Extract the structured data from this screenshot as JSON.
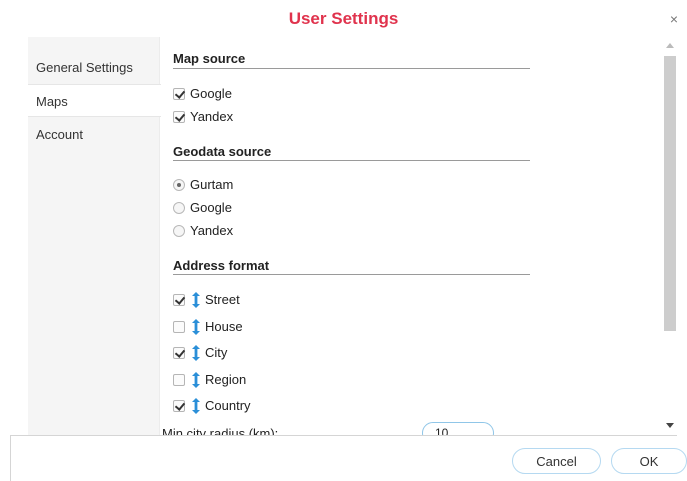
{
  "dialog": {
    "title": "User Settings",
    "close_symbol": "×"
  },
  "sidebar": {
    "items": [
      {
        "label": "General Settings"
      },
      {
        "label": "Maps",
        "active": true
      },
      {
        "label": "Account"
      }
    ]
  },
  "map_source": {
    "title": "Map source",
    "options": [
      {
        "label": "Google",
        "checked": true
      },
      {
        "label": "Yandex",
        "checked": true
      }
    ]
  },
  "geodata_source": {
    "title": "Geodata source",
    "options": [
      {
        "label": "Gurtam",
        "selected": true
      },
      {
        "label": "Google",
        "selected": false
      },
      {
        "label": "Yandex",
        "selected": false
      }
    ]
  },
  "address_format": {
    "title": "Address format",
    "items": [
      {
        "label": "Street",
        "checked": true
      },
      {
        "label": "House",
        "checked": false
      },
      {
        "label": "City",
        "checked": true
      },
      {
        "label": "Region",
        "checked": false
      },
      {
        "label": "Country",
        "checked": true
      }
    ]
  },
  "min_city_radius": {
    "label": "Min city radius (km):",
    "value": "10"
  },
  "footer": {
    "cancel_label": "Cancel",
    "ok_label": "OK"
  },
  "colors": {
    "title": "#e0334d",
    "drag_icon": "#2b8fd8",
    "button_border": "#b5d9f1"
  },
  "icons": {
    "close": "close-icon",
    "drag": "drag-handle-icon"
  }
}
